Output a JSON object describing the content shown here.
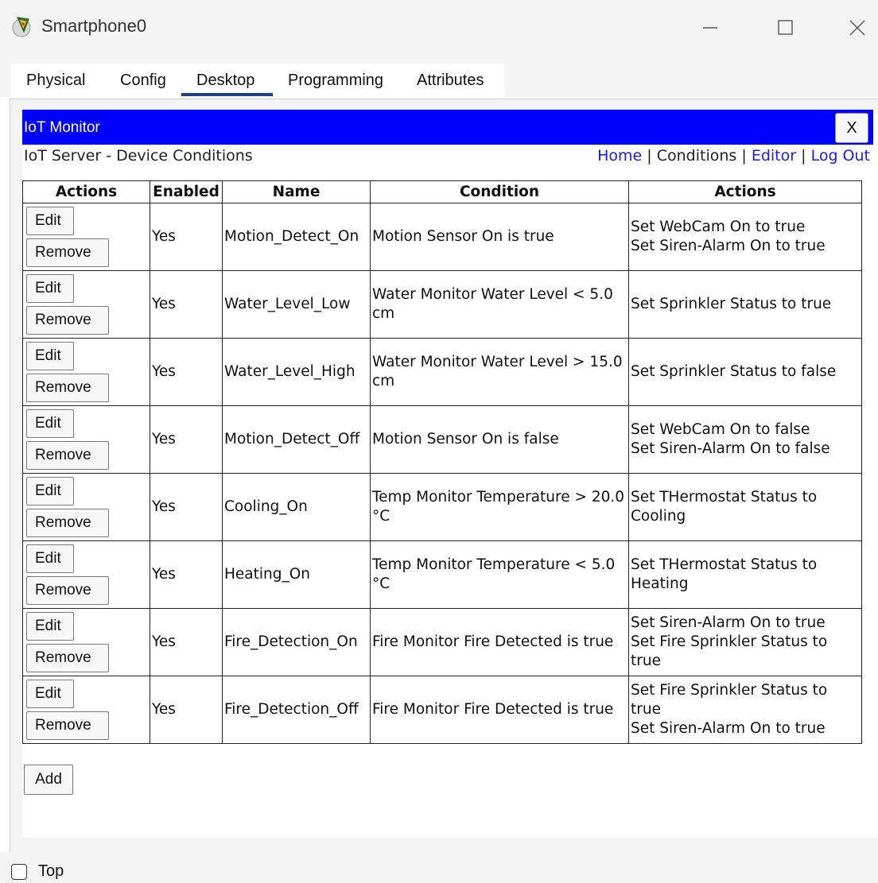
{
  "window": {
    "title": "Smartphone0",
    "icon": "packet-tracer-device-icon"
  },
  "tabs": [
    {
      "label": "Physical",
      "active": false
    },
    {
      "label": "Config",
      "active": false
    },
    {
      "label": "Desktop",
      "active": true
    },
    {
      "label": "Programming",
      "active": false
    },
    {
      "label": "Attributes",
      "active": false
    }
  ],
  "browser": {
    "title": "IoT Monitor",
    "close_label": "X",
    "bar_color": "#0000ff"
  },
  "page": {
    "heading": "IoT Server - Device Conditions",
    "nav": {
      "home": "Home",
      "conditions": "Conditions",
      "editor": "Editor",
      "logout": "Log Out",
      "separator": "|"
    }
  },
  "table": {
    "headers": [
      "Actions",
      "Enabled",
      "Name",
      "Condition",
      "Actions"
    ],
    "edit_label": "Edit",
    "remove_label": "Remove",
    "rows": [
      {
        "enabled": "Yes",
        "name": "Motion_Detect_On",
        "condition": "Motion Sensor On is true",
        "actions": [
          "Set WebCam On to true",
          "Set Siren-Alarm On to true"
        ]
      },
      {
        "enabled": "Yes",
        "name": "Water_Level_Low",
        "condition": "Water Monitor Water Level < 5.0 cm",
        "actions": [
          "Set Sprinkler Status to true"
        ]
      },
      {
        "enabled": "Yes",
        "name": "Water_Level_High",
        "condition": "Water Monitor Water Level > 15.0 cm",
        "actions": [
          "Set Sprinkler Status to false"
        ]
      },
      {
        "enabled": "Yes",
        "name": "Motion_Detect_Off",
        "condition": "Motion Sensor On is false",
        "actions": [
          "Set WebCam On to false",
          "Set Siren-Alarm On to false"
        ]
      },
      {
        "enabled": "Yes",
        "name": "Cooling_On",
        "condition": "Temp Monitor Temperature > 20.0 °C",
        "actions": [
          "Set THermostat Status to Cooling"
        ]
      },
      {
        "enabled": "Yes",
        "name": "Heating_On",
        "condition": "Temp Monitor Temperature < 5.0 °C",
        "actions": [
          "Set THermostat Status to Heating"
        ]
      },
      {
        "enabled": "Yes",
        "name": "Fire_Detection_On",
        "condition": "Fire Monitor Fire Detected is true",
        "actions": [
          "Set Siren-Alarm On to true",
          "Set Fire Sprinkler Status to true"
        ]
      },
      {
        "enabled": "Yes",
        "name": "Fire_Detection_Off",
        "condition": "Fire Monitor Fire Detected is true",
        "actions": [
          "Set Fire Sprinkler Status to true",
          "Set Siren-Alarm On to true"
        ]
      }
    ]
  },
  "add_label": "Add",
  "footer": {
    "top_label": "Top",
    "top_checked": false
  }
}
